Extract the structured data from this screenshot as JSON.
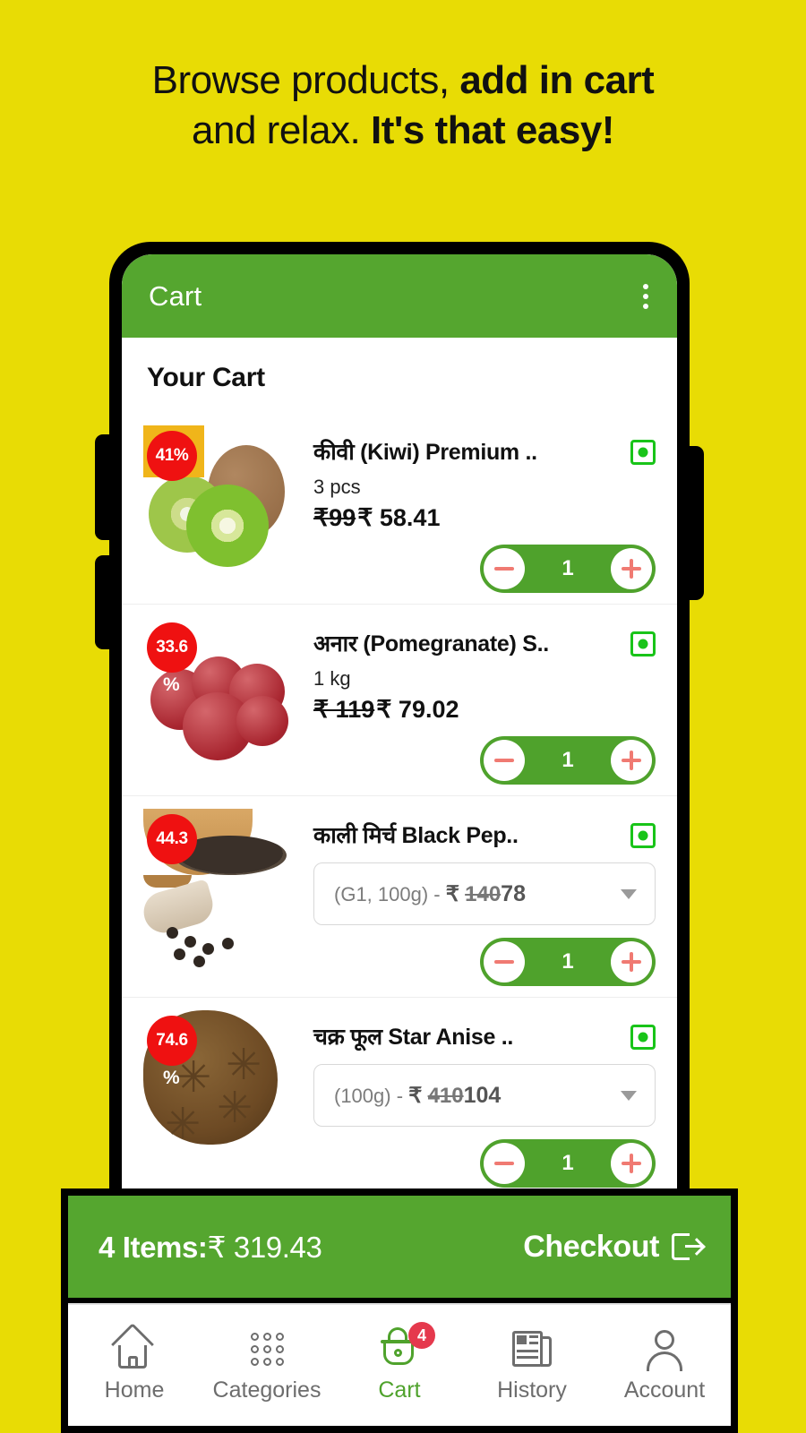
{
  "promo": {
    "line1_normal": "Browse products, ",
    "line1_strong": "add in cart",
    "line2_normal": "and relax. ",
    "line2_strong": "It's that easy!"
  },
  "colors": {
    "background_yellow": "#e8dc05",
    "brand_green": "#55a62f",
    "stepper_green": "#4fa22c",
    "badge_red": "#ef1111",
    "nav_badge_red": "#e5394d",
    "veg_green": "#19c419",
    "stepper_icon": "#f07a72"
  },
  "appbar": {
    "title": "Cart",
    "menu_icon": "kebab-menu-icon"
  },
  "cart": {
    "heading": "Your Cart",
    "items": [
      {
        "discount_badge": "41%",
        "discount_value": "41",
        "discount_suffix": "%",
        "title": "कीवी (Kiwi) Premium ..",
        "unit": "3 pcs",
        "old_price": "₹99",
        "new_price": "₹ 58.41",
        "veg_indicator": "veg",
        "quantity": "1",
        "has_variant": false
      },
      {
        "discount_badge": "33.6",
        "discount_value": "33.6",
        "discount_suffix": "%",
        "title": "अनार (Pomegranate) S..",
        "unit": "1 kg",
        "old_price": "₹ 119",
        "new_price": "₹ 79.02",
        "veg_indicator": "veg",
        "quantity": "1",
        "has_variant": false
      },
      {
        "discount_badge": "44.3",
        "discount_value": "44.3",
        "discount_suffix": "%",
        "title": "काली मिर्च Black Pep..",
        "veg_indicator": "veg",
        "quantity": "1",
        "has_variant": true,
        "variant_prefix": "(G1, 100g) - ",
        "variant_rupee": "₹",
        "variant_old": "140",
        "variant_new": "78"
      },
      {
        "discount_badge": "74.6",
        "discount_value": "74.6",
        "discount_suffix": "%",
        "title": "चक्र फूल Star Anise ..",
        "veg_indicator": "veg",
        "quantity": "1",
        "has_variant": true,
        "variant_prefix": "(100g) - ",
        "variant_rupee": "₹",
        "variant_old": "410",
        "variant_new": "104"
      }
    ]
  },
  "checkout": {
    "items_label": "4 Items:",
    "total": "₹ 319.43",
    "button_label": "Checkout",
    "button_icon": "exit-arrow-icon"
  },
  "bottom_nav": {
    "items": [
      {
        "label": "Home",
        "icon": "home-icon",
        "active": false
      },
      {
        "label": "Categories",
        "icon": "grid-dots-icon",
        "active": false
      },
      {
        "label": "Cart",
        "icon": "basket-icon",
        "active": true,
        "badge": "4"
      },
      {
        "label": "History",
        "icon": "newspaper-icon",
        "active": false
      },
      {
        "label": "Account",
        "icon": "person-icon",
        "active": false
      }
    ]
  }
}
